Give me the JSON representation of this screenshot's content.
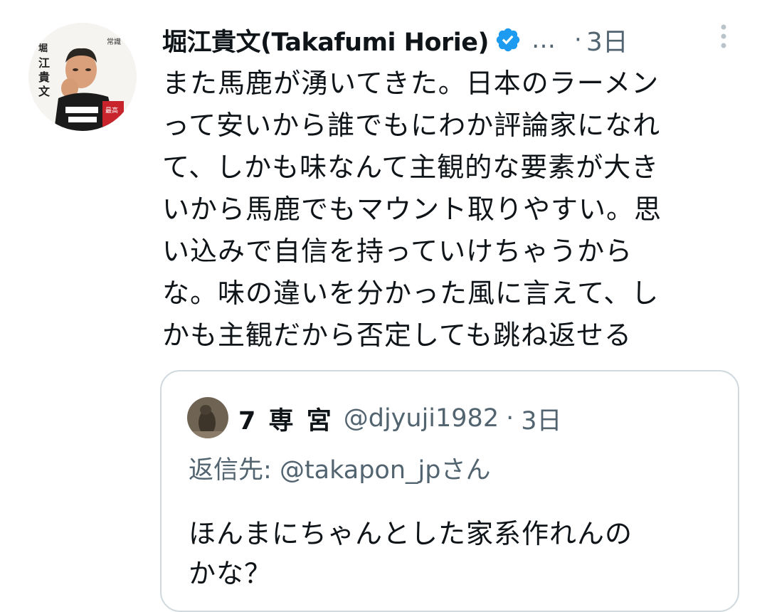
{
  "tweet": {
    "author_name": "堀江貴文(Takafumi Horie)",
    "verified_icon": "verified-badge-icon",
    "overflow_ellipsis": "…",
    "separator": "·",
    "time": "3日",
    "more_icon": "more-vertical-icon",
    "text_lines": [
      "また馬鹿が湧いてきた。日本のラーメン",
      "って安いから誰でもにわか評論家になれ",
      "て、しかも味なんて主観的な要素が大き",
      "いから馬鹿でもマウント取りやすい。思",
      "い込みで自信を持っていけちゃうから",
      "な。味の違いを分かった風に言えて、し",
      "かも主観だから否定しても跳ね返せる"
    ]
  },
  "quoted_tweet": {
    "author_name": "7 専 宮",
    "handle": "@djyuji1982",
    "separator": "·",
    "time": "3日",
    "reply_prefix": "返信先:",
    "reply_mention": "@takapon_jpさん",
    "text_lines": [
      "ほんまにちゃんとした家系作れんの",
      "かな？"
    ]
  },
  "colors": {
    "text": "#0f1419",
    "secondary": "#536471",
    "verified": "#1d9bf0",
    "border": "#cfd9de"
  }
}
